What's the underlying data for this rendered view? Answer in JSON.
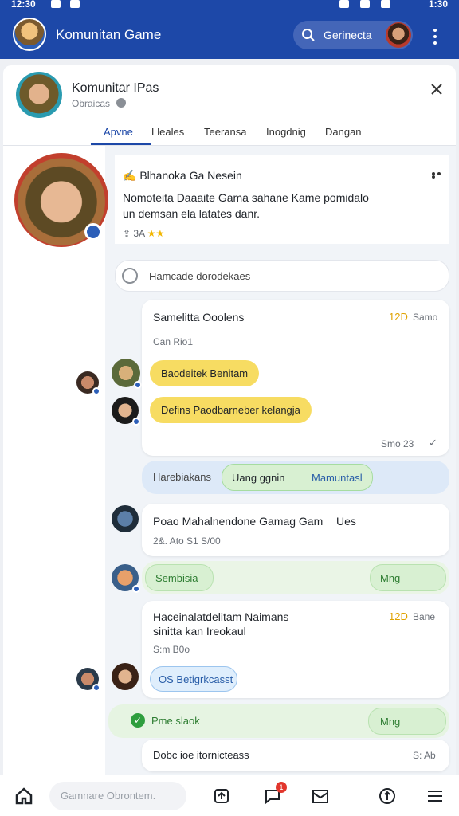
{
  "status_bar": {
    "time": "12:30",
    "right_time": "1:30"
  },
  "app_bar": {
    "title": "Komunitan Game",
    "search_text": "Gerinecta"
  },
  "sheet": {
    "title": "Komunitar IPas",
    "subtitle": "Obraicas",
    "tabs": [
      "Apvne",
      "Lleales",
      "Teeransa",
      "Inogdnig",
      "Dangan"
    ],
    "active_tab": 0
  },
  "post": {
    "name_prefix": "✍",
    "name": "Blhanoka",
    "name_suffix": "Ga Nesein",
    "text_line1": "Nomoteita Daaaite Gama sahane Kame pomidalo",
    "text_line2": "un demsan ela latates danr.",
    "stats": "3A",
    "rating_stars": 2
  },
  "prompt_row": {
    "text": "Hamcade dorodekaes"
  },
  "message1": {
    "title": "Samelitta Ooolens",
    "count": "12D",
    "label": "Samo",
    "meta": "Can  Rio1",
    "bubble1": "Baodeitek Benitam",
    "bubble2": "Defins  Paodbarneber kelangja",
    "footer": "Smo 23"
  },
  "status_row": {
    "label": "Harebiakans",
    "pill": "Uang ggnin",
    "pill_link": "Mamuntasl"
  },
  "message2": {
    "title": "Poao Mahalnendone Gamag Gam",
    "suffix": "Ues",
    "meta": "2&.  Ato   S1   S/00"
  },
  "green_row": {
    "label": "Sembisia",
    "right": "Mng"
  },
  "message3": {
    "title_line1": "Haceinalatdelitam Naimans",
    "title_line2": "sinitta kan Ireokaul",
    "count": "12D",
    "label": "Bane",
    "meta": "S:m  B0o",
    "blue_pill": "OS Betigrkcasst"
  },
  "done_row": {
    "label": "Pme slaok",
    "right": "Mng"
  },
  "last_row": {
    "text": "Dobc ioe itornicteass",
    "right": "S: Ab"
  },
  "bottom_nav": {
    "compose_placeholder": "Gamnare Obrontem.",
    "notif_count": "1"
  },
  "colors": {
    "primary": "#1d48a8",
    "accent_yellow": "#f7dc62",
    "success": "#2e9e3e"
  }
}
